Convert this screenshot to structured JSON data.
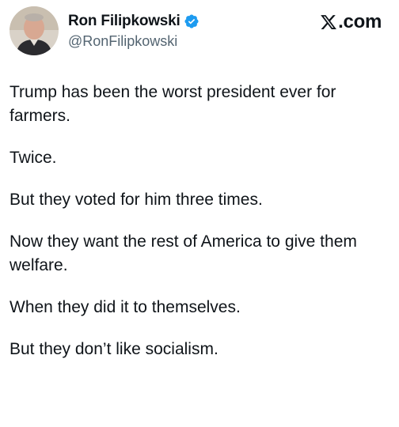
{
  "author": {
    "display_name": "Ron Filipkowski",
    "handle": "@RonFilipkowski",
    "verified": true,
    "verified_color": "#1d9bf0"
  },
  "brand": {
    "logo_icon": "x-logo-icon",
    "text": ".com"
  },
  "tweet": {
    "paragraphs": [
      "Trump has been the worst president ever for farmers.",
      "Twice.",
      "But they voted for him three times.",
      "Now they want the rest of America to give them welfare.",
      "When they did it to themselves.",
      "But they don’t like socialism."
    ]
  }
}
